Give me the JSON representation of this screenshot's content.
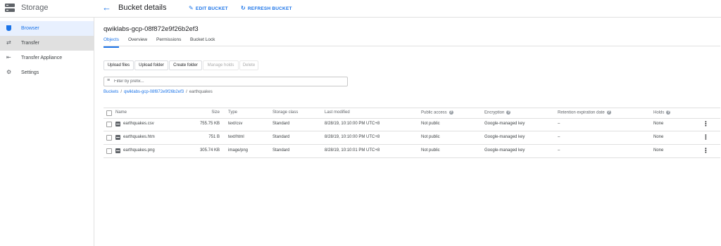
{
  "app": {
    "product_title": "Storage",
    "page_title": "Bucket details"
  },
  "header_actions": {
    "edit_label": "EDIT BUCKET",
    "refresh_label": "REFRESH BUCKET"
  },
  "sidebar": {
    "items": [
      {
        "label": "Browser",
        "icon": "bucket-icon"
      },
      {
        "label": "Transfer",
        "icon": "transfer-icon"
      },
      {
        "label": "Transfer Appliance",
        "icon": "appliance-icon"
      },
      {
        "label": "Settings",
        "icon": "gear-icon"
      }
    ]
  },
  "bucket": {
    "name": "qwiklabs-gcp-08f872e9f26b2ef3"
  },
  "tabs": [
    {
      "label": "Objects"
    },
    {
      "label": "Overview"
    },
    {
      "label": "Permissions"
    },
    {
      "label": "Bucket Lock"
    }
  ],
  "toolbar": {
    "upload_files": "Upload files",
    "upload_folder": "Upload folder",
    "create_folder": "Create folder",
    "manage_holds": "Manage holds",
    "delete": "Delete"
  },
  "filter": {
    "placeholder": "Filter by prefix...",
    "value": ""
  },
  "breadcrumb": {
    "root": "Buckets",
    "bucket": "qwiklabs-gcp-08f872e9f26b2ef3",
    "folder": "earthquakes",
    "separator": "/"
  },
  "table": {
    "columns": {
      "name": "Name",
      "size": "Size",
      "type": "Type",
      "storage_class": "Storage class",
      "last_modified": "Last modified",
      "public_access": "Public access",
      "encryption": "Encryption",
      "retention": "Retention expiration date",
      "holds": "Holds"
    },
    "help_glyph": "?",
    "menu_glyph": "⋮",
    "rows": [
      {
        "name": "earthquakes.csv",
        "size": "755.75 KB",
        "type": "text/csv",
        "storage_class": "Standard",
        "last_modified": "8/28/19, 10:10:00 PM UTC+8",
        "public_access": "Not public",
        "encryption": "Google-managed key",
        "retention": "–",
        "holds": "None"
      },
      {
        "name": "earthquakes.htm",
        "size": "751 B",
        "type": "text/html",
        "storage_class": "Standard",
        "last_modified": "8/28/19, 10:10:00 PM UTC+8",
        "public_access": "Not public",
        "encryption": "Google-managed key",
        "retention": "–",
        "holds": "None"
      },
      {
        "name": "earthquakes.png",
        "size": "305.74 KB",
        "type": "image/png",
        "storage_class": "Standard",
        "last_modified": "8/28/19, 10:10:01 PM UTC+8",
        "public_access": "Not public",
        "encryption": "Google-managed key",
        "retention": "–",
        "holds": "None"
      }
    ]
  },
  "colors": {
    "accent": "#1a73e8",
    "sidebar_active_bg": "#e8f0fe",
    "border": "#e0e0e0"
  }
}
